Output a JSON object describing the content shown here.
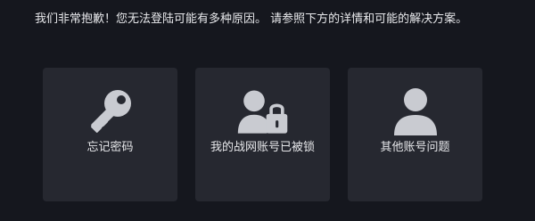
{
  "message": "我们非常抱歉！您无法登陆可能有多种原因。 请参照下方的详情和可能的解决方案。",
  "options": [
    {
      "label": "忘记密码",
      "icon": "key-icon"
    },
    {
      "label": "我的战网账号已被锁",
      "icon": "locked-account-icon"
    },
    {
      "label": "其他账号问题",
      "icon": "user-icon"
    }
  ],
  "colors": {
    "background": "#15171e",
    "card": "#262830",
    "icon": "#c9cbd1",
    "text": "#e6e7ea"
  }
}
